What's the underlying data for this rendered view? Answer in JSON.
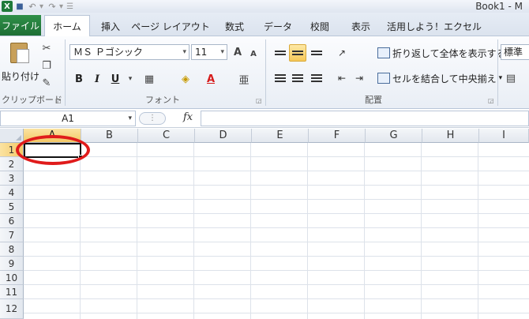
{
  "title_bar": {
    "window_title": "Book1 - M",
    "icons": [
      "excel-logo",
      "save",
      "undo",
      "redo",
      "customize-qat"
    ]
  },
  "tabs": {
    "file_label": "ファイル",
    "items": [
      {
        "label": "ホーム",
        "active": true
      },
      {
        "label": "挿入"
      },
      {
        "label": "ページ レイアウト"
      },
      {
        "label": "数式"
      },
      {
        "label": "データ"
      },
      {
        "label": "校閲"
      },
      {
        "label": "表示"
      },
      {
        "label": "活用しよう！エクセル"
      }
    ]
  },
  "ribbon": {
    "clipboard": {
      "paste_label": "貼り付け",
      "group_label": "クリップボード"
    },
    "font": {
      "font_name": "ＭＳ Ｐゴシック",
      "font_size": "11",
      "grow": "A",
      "shrink": "A",
      "bold": "B",
      "italic": "I",
      "underline": "U",
      "font_color": "A",
      "phonetic": "亜",
      "group_label": "フォント"
    },
    "alignment": {
      "wrap_text": "折り返して全体を表示する",
      "merge_center": "セルを結合して中央揃え",
      "group_label": "配置"
    },
    "number": {
      "format": "標準"
    }
  },
  "formula_bar": {
    "name_box": "A1",
    "fx": "fx",
    "formula": ""
  },
  "sheet": {
    "columns": [
      "A",
      "B",
      "C",
      "D",
      "E",
      "F",
      "G",
      "H",
      "I"
    ],
    "rows": [
      "1",
      "2",
      "3",
      "4",
      "5",
      "6",
      "7",
      "8",
      "9",
      "10",
      "11",
      "12"
    ],
    "active_cell": "A1"
  },
  "colors": {
    "file_tab": "#1e6f35",
    "selection_header": "#f3c866",
    "annotation": "#e01b1b"
  }
}
